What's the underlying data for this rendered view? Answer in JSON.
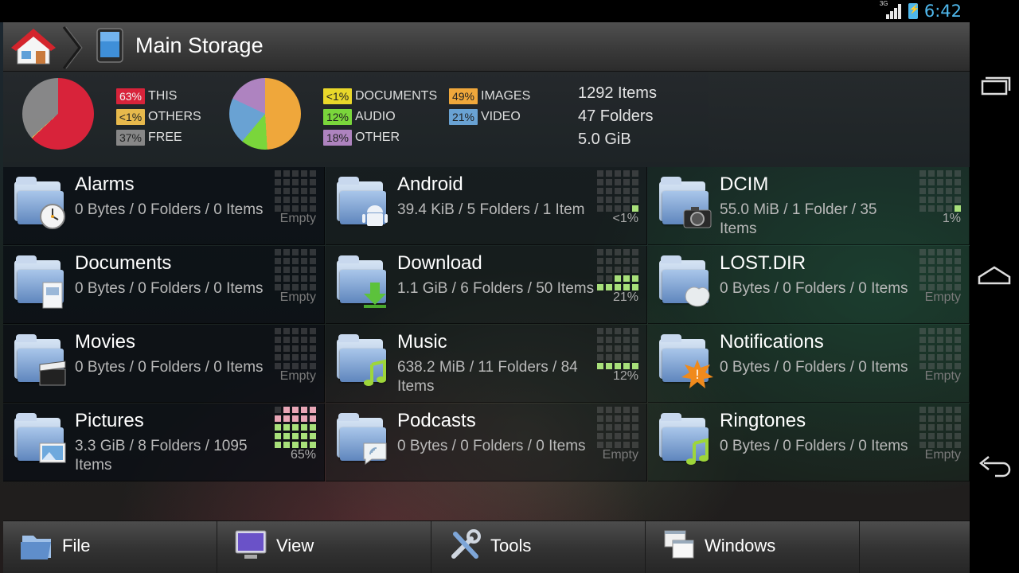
{
  "status": {
    "network": "3G",
    "time": "6:42"
  },
  "titlebar": {
    "title": "Main Storage"
  },
  "usage": {
    "storage_legend": [
      {
        "pct": "63%",
        "label": "THIS",
        "color": "#e3233b",
        "text": "#fff"
      },
      {
        "pct": "<1%",
        "label": "OTHERS",
        "color": "#f2c14e",
        "text": "#222"
      },
      {
        "pct": "37%",
        "label": "FREE",
        "color": "#8d8d8d",
        "text": "#222"
      }
    ],
    "type_legend": [
      {
        "pct": "<1%",
        "label": "DOCUMENTS",
        "color": "#f5e12a",
        "text": "#222"
      },
      {
        "pct": "12%",
        "label": "AUDIO",
        "color": "#80e03c",
        "text": "#222"
      },
      {
        "pct": "18%",
        "label": "OTHER",
        "color": "#b689c8",
        "text": "#222"
      },
      {
        "pct": "49%",
        "label": "IMAGES",
        "color": "#fbae3c",
        "text": "#222"
      },
      {
        "pct": "21%",
        "label": "VIDEO",
        "color": "#6ea9dd",
        "text": "#222"
      }
    ],
    "summary": {
      "items": "1292 Items",
      "folders": "47 Folders",
      "size": "5.0 GiB"
    }
  },
  "folders": [
    {
      "name": "Alarms",
      "info": "0 Bytes / 0 Folders / 0 Items",
      "usage": "Empty",
      "level": 0,
      "emblem": "clock-icon"
    },
    {
      "name": "Android",
      "info": "39.4 KiB / 5 Folders / 1 Item",
      "usage": "<1%",
      "level": 1,
      "emblem": "android-icon"
    },
    {
      "name": "DCIM",
      "info": "55.0 MiB / 1 Folder / 35 Items",
      "usage": "1%",
      "level": 1,
      "emblem": "camera-icon"
    },
    {
      "name": "Documents",
      "info": "0 Bytes / 0 Folders / 0 Items",
      "usage": "Empty",
      "level": 0,
      "emblem": "document-icon"
    },
    {
      "name": "Download",
      "info": "1.1 GiB / 6 Folders / 50 Items",
      "usage": "21%",
      "level": 21,
      "emblem": "download-arrow-icon"
    },
    {
      "name": "LOST.DIR",
      "info": "0 Bytes / 0 Folders / 0 Items",
      "usage": "Empty",
      "level": 0,
      "emblem": "broken-file-icon"
    },
    {
      "name": "Movies",
      "info": "0 Bytes / 0 Folders / 0 Items",
      "usage": "Empty",
      "level": 0,
      "emblem": "clapperboard-icon"
    },
    {
      "name": "Music",
      "info": "638.2 MiB / 11 Folders / 84 Items",
      "usage": "12%",
      "level": 12,
      "emblem": "music-note-icon"
    },
    {
      "name": "Notifications",
      "info": "0 Bytes / 0 Folders / 0 Items",
      "usage": "Empty",
      "level": 0,
      "emblem": "alert-icon"
    },
    {
      "name": "Pictures",
      "info": "3.3 GiB / 8 Folders / 1095 Items",
      "usage": "65%",
      "level": 65,
      "emblem": "picture-icon"
    },
    {
      "name": "Podcasts",
      "info": "0 Bytes / 0 Folders / 0 Items",
      "usage": "Empty",
      "level": 0,
      "emblem": "podcast-icon"
    },
    {
      "name": "Ringtones",
      "info": "0 Bytes / 0 Folders / 0 Items",
      "usage": "Empty",
      "level": 0,
      "emblem": "music-note-icon"
    }
  ],
  "menu": [
    {
      "label": "File",
      "icon": "folder-icon"
    },
    {
      "label": "View",
      "icon": "monitor-icon"
    },
    {
      "label": "Tools",
      "icon": "tools-icon"
    },
    {
      "label": "Windows",
      "icon": "windows-icon"
    }
  ],
  "nav": [
    "recent-apps-icon",
    "home-icon",
    "back-icon"
  ]
}
